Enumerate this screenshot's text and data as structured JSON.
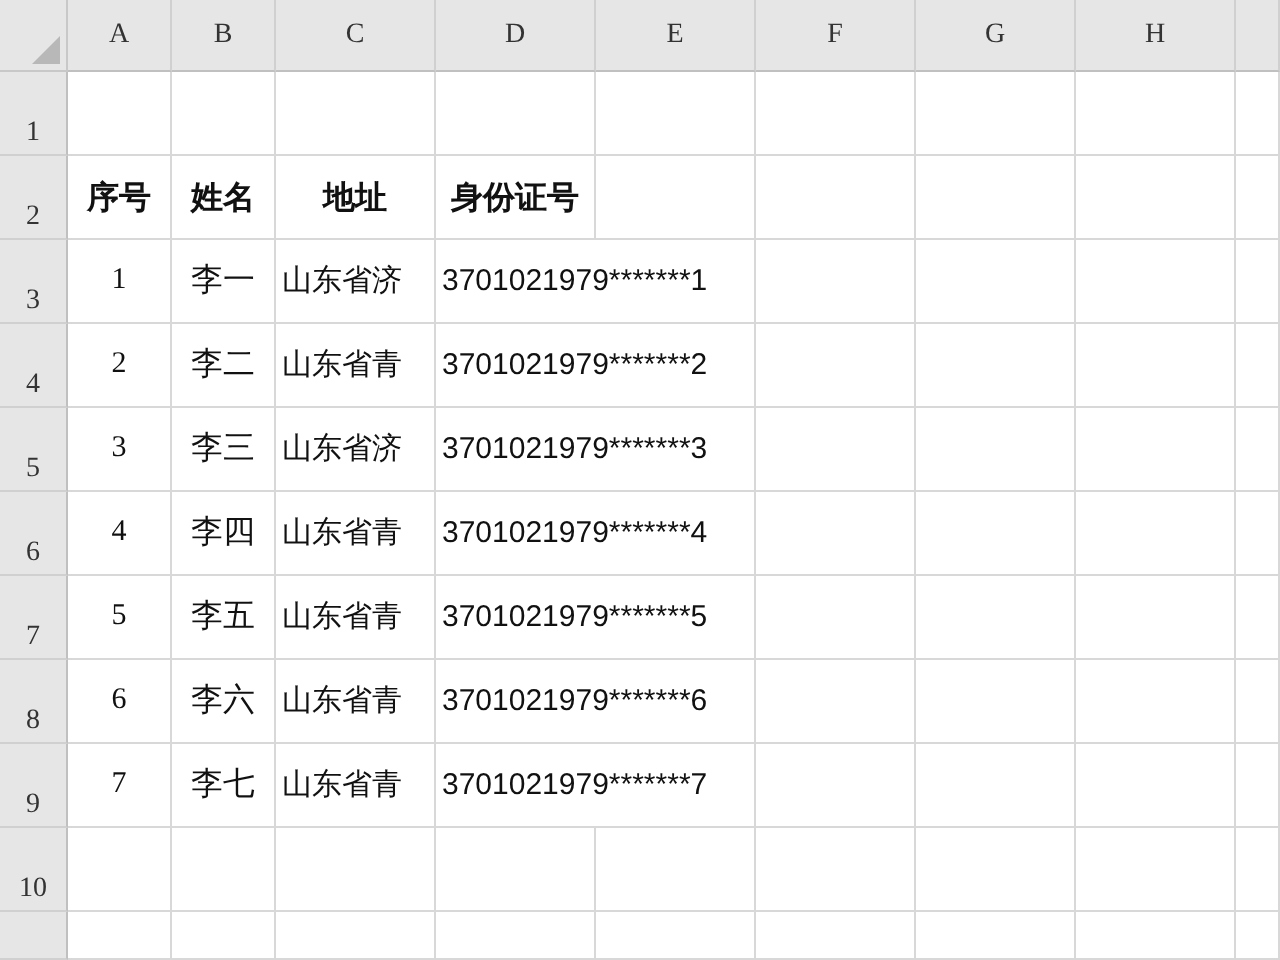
{
  "columns": [
    "A",
    "B",
    "C",
    "D",
    "E",
    "F",
    "G",
    "H"
  ],
  "row_numbers": [
    "1",
    "2",
    "3",
    "4",
    "5",
    "6",
    "7",
    "8",
    "9",
    "10"
  ],
  "table": {
    "header": [
      "序号",
      "姓名",
      "地址",
      "身份证号"
    ],
    "rows": [
      {
        "no": "1",
        "name": "李一",
        "address": "山东省济",
        "id_number": "3701021979*******1"
      },
      {
        "no": "2",
        "name": "李二",
        "address": "山东省青",
        "id_number": "3701021979*******2"
      },
      {
        "no": "3",
        "name": "李三",
        "address": "山东省济",
        "id_number": "3701021979*******3"
      },
      {
        "no": "4",
        "name": "李四",
        "address": "山东省青",
        "id_number": "3701021979*******4"
      },
      {
        "no": "5",
        "name": "李五",
        "address": "山东省青",
        "id_number": "3701021979*******5"
      },
      {
        "no": "6",
        "name": "李六",
        "address": "山东省青",
        "id_number": "3701021979*******6"
      },
      {
        "no": "7",
        "name": "李七",
        "address": "山东省青",
        "id_number": "3701021979*******7"
      }
    ]
  }
}
